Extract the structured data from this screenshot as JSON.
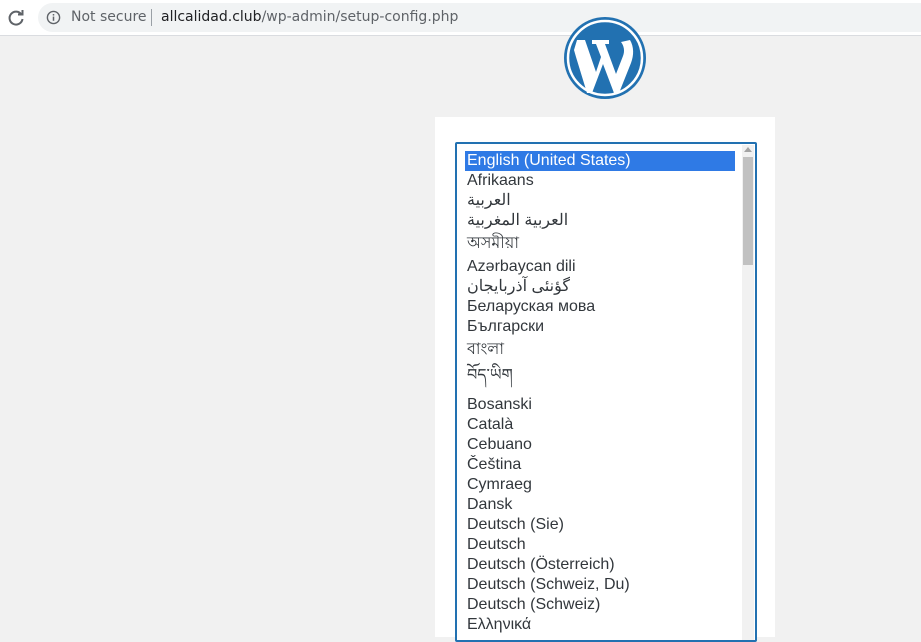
{
  "browser": {
    "security_label": "Not secure",
    "url_host": "allcalidad.club",
    "url_path": "/wp-admin/setup-config.php"
  },
  "icons": {
    "reload": "reload-icon",
    "info": "info-icon",
    "logo": "wordpress-logo"
  },
  "colors": {
    "accent": "#2271b1",
    "selected": "#2f7ae5",
    "background": "#f1f1f1"
  },
  "language_select": {
    "selected": "English (United States)",
    "options": [
      "English (United States)",
      "Afrikaans",
      "العربية",
      "العربية المغربية",
      "অসমীয়া",
      "Azərbaycan dili",
      "گؤنئی آذربایجان",
      "Беларуская мова",
      "Български",
      "বাংলা",
      "བོད་ཡིག",
      "Bosanski",
      "Català",
      "Cebuano",
      "Čeština",
      "Cymraeg",
      "Dansk",
      "Deutsch (Sie)",
      "Deutsch",
      "Deutsch (Österreich)",
      "Deutsch (Schweiz, Du)",
      "Deutsch (Schweiz)",
      "Ελληνικά"
    ]
  }
}
